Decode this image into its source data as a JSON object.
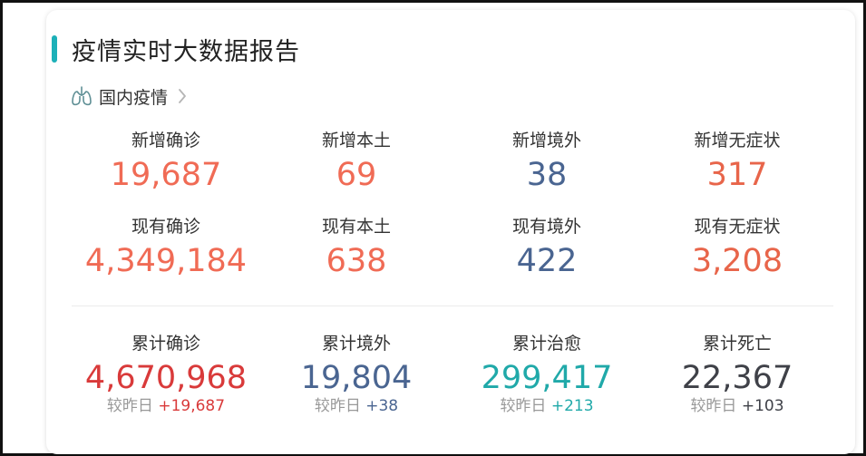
{
  "header": {
    "title": "疫情实时大数据报告",
    "section_label": "国内疫情",
    "accent_color": "#1cb0b8",
    "section_icon": "lung-icon",
    "chevron_icon": "chevron-right-icon"
  },
  "rows": [
    [
      {
        "label": "新增确诊",
        "value": "19,687",
        "color": "#f06b55"
      },
      {
        "label": "新增本土",
        "value": "69",
        "color": "#f06b55"
      },
      {
        "label": "新增境外",
        "value": "38",
        "color": "#4a6591"
      },
      {
        "label": "新增无症状",
        "value": "317",
        "color": "#e8654a"
      }
    ],
    [
      {
        "label": "现有确诊",
        "value": "4,349,184",
        "color": "#f06b55"
      },
      {
        "label": "现有本土",
        "value": "638",
        "color": "#f06b55"
      },
      {
        "label": "现有境外",
        "value": "422",
        "color": "#4a6591"
      },
      {
        "label": "现有无症状",
        "value": "3,208",
        "color": "#e8654a"
      }
    ]
  ],
  "totals": [
    {
      "label": "累计确诊",
      "value": "4,670,968",
      "color": "#d93a3a",
      "compare_prefix": "较昨日",
      "compare_delta": "+19,687"
    },
    {
      "label": "累计境外",
      "value": "19,804",
      "color": "#4a6591",
      "compare_prefix": "较昨日",
      "compare_delta": "+38"
    },
    {
      "label": "累计治愈",
      "value": "299,417",
      "color": "#20a9a9",
      "compare_prefix": "较昨日",
      "compare_delta": "+213"
    },
    {
      "label": "累计死亡",
      "value": "22,367",
      "color": "#3f4148",
      "compare_prefix": "较昨日",
      "compare_delta": "+103"
    }
  ]
}
